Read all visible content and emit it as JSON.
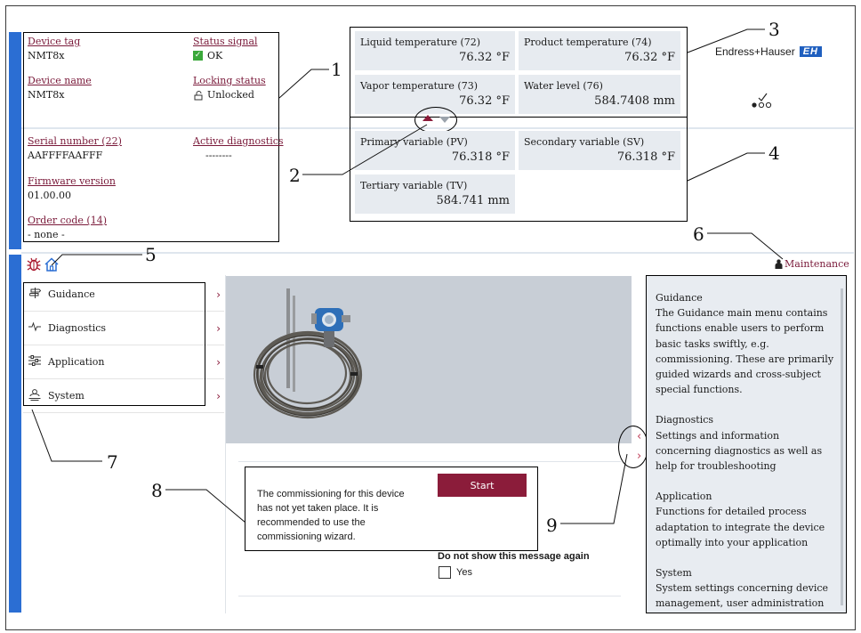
{
  "header": {
    "device_tag_label": "Device tag",
    "device_tag_value": "NMT8x",
    "status_signal_label": "Status signal",
    "status_signal_value": "OK",
    "device_name_label": "Device name",
    "device_name_value": "NMT8x",
    "locking_status_label": "Locking status",
    "locking_status_value": "Unlocked",
    "serial_number_label": "Serial number (22)",
    "serial_number_value": "AAFFFFAAFFF",
    "active_diagnostics_label": "Active diagnostics",
    "active_diagnostics_value": "--------",
    "firmware_version_label": "Firmware version",
    "firmware_version_value": "01.00.00",
    "order_code_label": "Order code (14)",
    "order_code_value": "- none -"
  },
  "measurements": [
    {
      "label": "Liquid temperature (72)",
      "value": "76.32 °F"
    },
    {
      "label": "Product temperature (74)",
      "value": "76.32 °F"
    },
    {
      "label": "Vapor temperature (73)",
      "value": "76.32 °F"
    },
    {
      "label": "Water level (76)",
      "value": "584.7408 mm"
    }
  ],
  "variables": [
    {
      "label": "Primary variable (PV)",
      "value": "76.318 °F"
    },
    {
      "label": "Secondary variable (SV)",
      "value": "76.318 °F"
    },
    {
      "label": "Tertiary variable (TV)",
      "value": "584.741 mm"
    }
  ],
  "brand": {
    "name": "Endress+Hauser",
    "mark": "EH",
    "color": "#1f5fbf"
  },
  "user_role": "Maintenance",
  "menu": [
    {
      "label": "Guidance",
      "icon": "guidance-icon"
    },
    {
      "label": "Diagnostics",
      "icon": "diagnostics-icon"
    },
    {
      "label": "Application",
      "icon": "application-icon"
    },
    {
      "label": "System",
      "icon": "system-icon"
    }
  ],
  "commissioning": {
    "message": "The commissioning for this device has not yet taken place. It is recommended to use the commissioning wizard.",
    "start_label": "Start",
    "dont_show_label": "Do not show this message again",
    "yes_label": "Yes"
  },
  "help": {
    "sections": [
      {
        "title": "Guidance",
        "text": "The Guidance main menu contains functions enable users to perform basic tasks swiftly, e.g. commissioning. These are primarily guided wizards and cross-subject special functions."
      },
      {
        "title": "Diagnostics",
        "text": "Settings and information concerning diagnostics as well as help for troubleshooting"
      },
      {
        "title": "Application",
        "text": "Functions for detailed process adaptation to integrate the device optimally into your application"
      },
      {
        "title": "System",
        "text": "System settings concerning device management, user administration or safety"
      }
    ]
  },
  "callouts": [
    "1",
    "2",
    "3",
    "4",
    "5",
    "6",
    "7",
    "8",
    "9"
  ],
  "colors": {
    "accent_blue": "#2b6ed3",
    "brand_red": "#8b1c3a",
    "tile_bg": "#e7ebf0",
    "image_bg": "#c8ced6"
  }
}
